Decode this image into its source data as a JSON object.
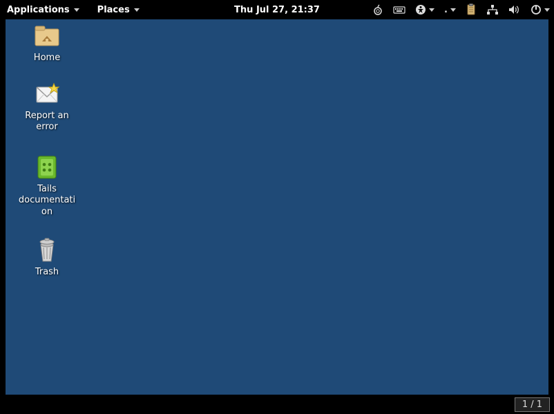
{
  "topbar": {
    "applications_label": "Applications",
    "places_label": "Places",
    "clock": "Thu Jul 27, 21:37",
    "language_label": "."
  },
  "desktop_icons": {
    "home": {
      "label": "Home"
    },
    "report": {
      "label": "Report an error"
    },
    "docs": {
      "label": "Tails documentation"
    },
    "trash": {
      "label": "Trash"
    }
  },
  "bottombar": {
    "workspace": "1 / 1"
  }
}
